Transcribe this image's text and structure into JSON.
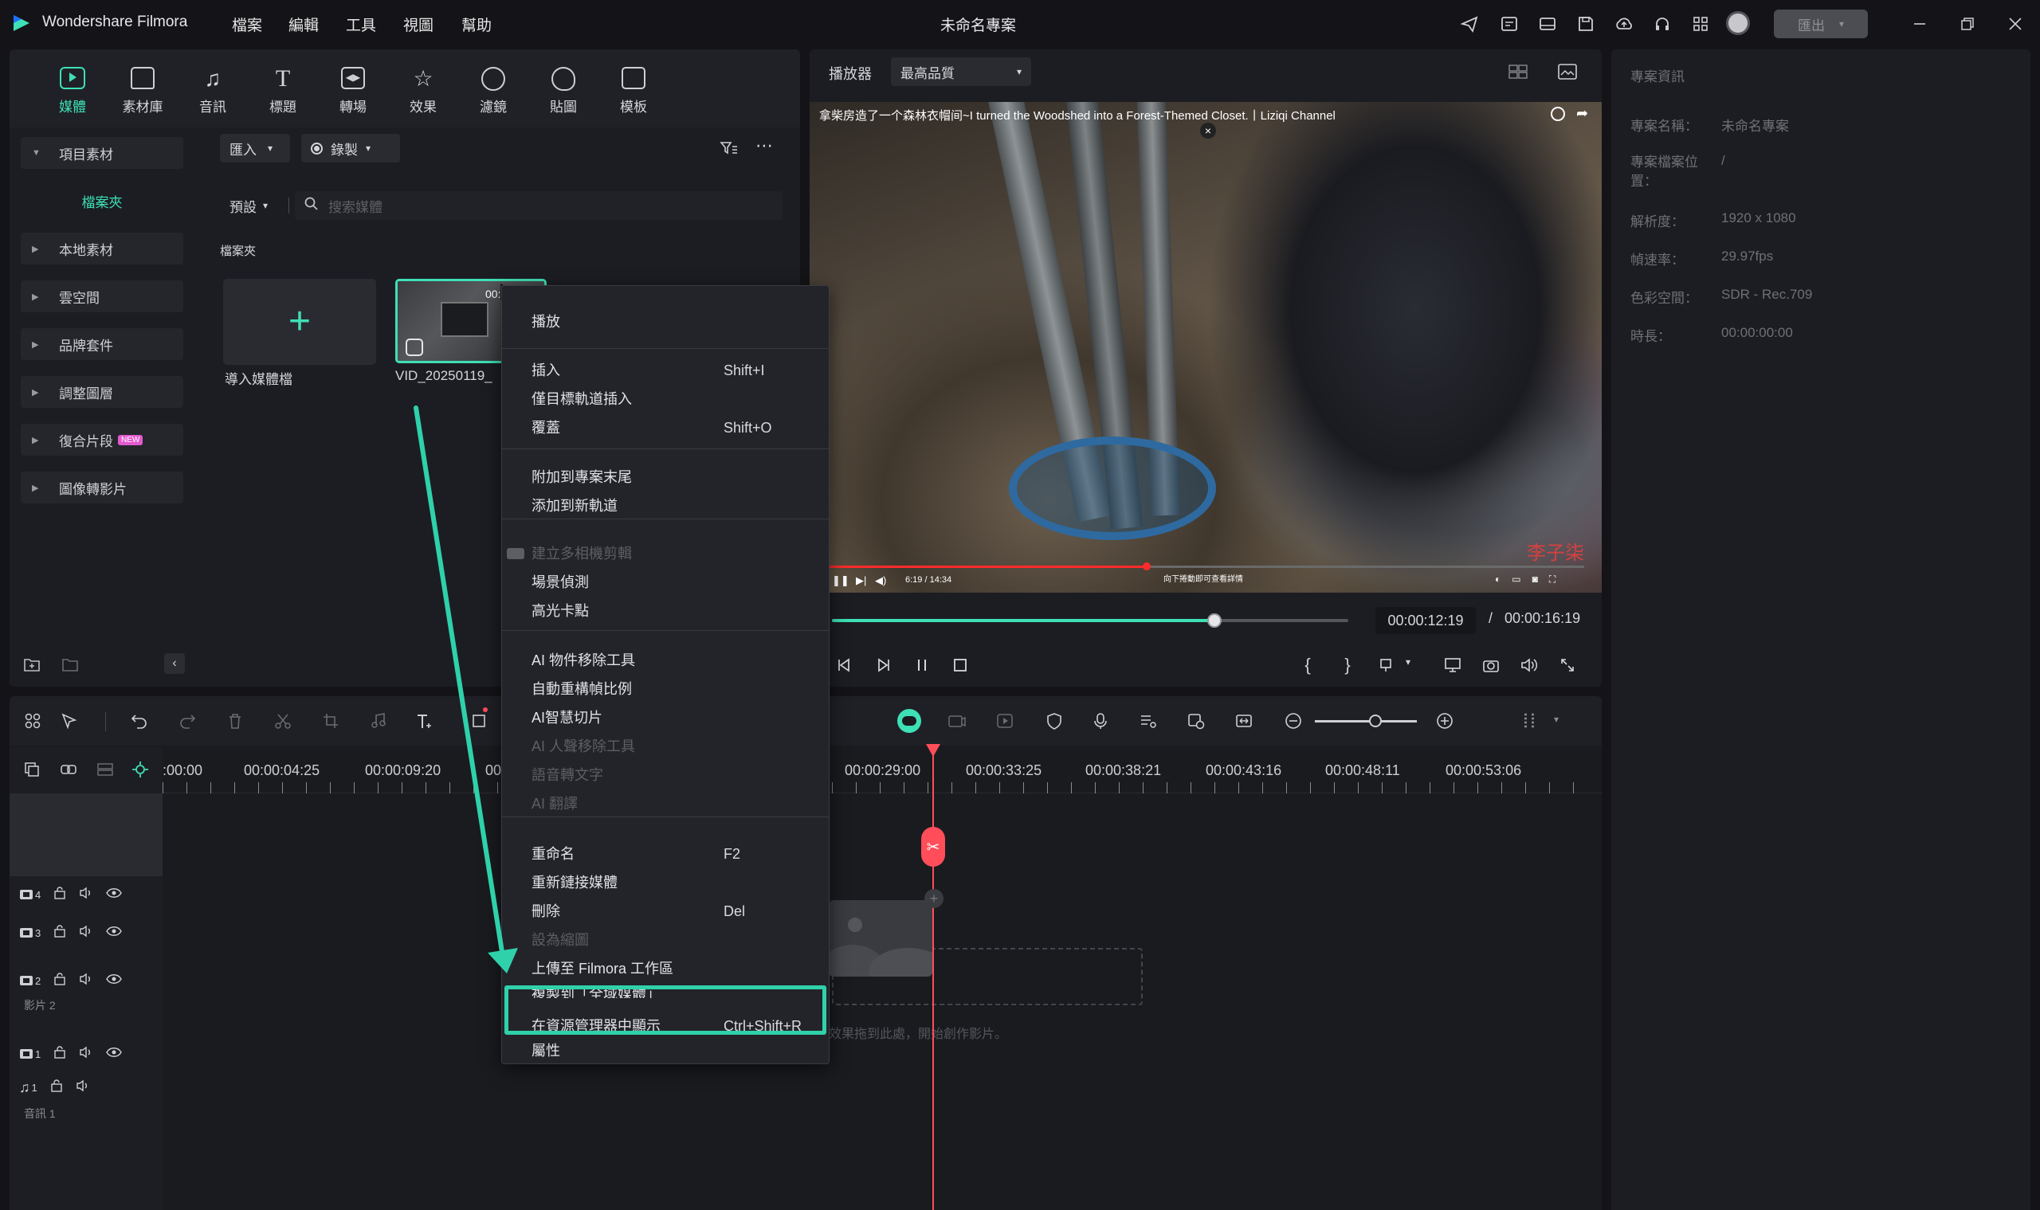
{
  "app": {
    "name": "Wondershare Filmora",
    "project_title": "未命名專案",
    "menu": [
      "檔案",
      "編輯",
      "工具",
      "視圖",
      "幫助"
    ],
    "export_label": "匯出"
  },
  "media_tabs": [
    {
      "label": "媒體",
      "active": true
    },
    {
      "label": "素材庫"
    },
    {
      "label": "音訊"
    },
    {
      "label": "標題"
    },
    {
      "label": "轉場"
    },
    {
      "label": "效果"
    },
    {
      "label": "濾鏡"
    },
    {
      "label": "貼圖"
    },
    {
      "label": "模板"
    }
  ],
  "sidebar": {
    "items": [
      {
        "label": "項目素材",
        "expanded": true
      },
      {
        "label": "檔案夾",
        "sub": true
      },
      {
        "label": "本地素材"
      },
      {
        "label": "雲空間"
      },
      {
        "label": "品牌套件"
      },
      {
        "label": "調整圖層"
      },
      {
        "label": "復合片段",
        "badge": "NEW"
      },
      {
        "label": "圖像轉影片"
      }
    ]
  },
  "media": {
    "import_label": "匯入",
    "record_label": "錄製",
    "sort_label": "預設",
    "search_placeholder": "搜索媒體",
    "folder_label": "檔案夾",
    "import_tile_label": "導入媒體檔",
    "clip_name": "VID_20250119_",
    "clip_time": "00:"
  },
  "player": {
    "label": "播放器",
    "quality": "最高品質",
    "video_title": "拿柴房造了一个森林衣帽间~I turned the Woodshed into a Forest-Themed Closet.丨Liziqi Channel",
    "embed_time": "6:19 / 14:34",
    "embed_hint": "向下捲動即可查看詳情",
    "watermark": "李子柒",
    "current_time": "00:00:12:19",
    "total_time": "00:00:16:19",
    "progress": 0.74
  },
  "project_info": {
    "header": "專案資訊",
    "rows": [
      {
        "label": "專案名稱：",
        "value": "未命名專案"
      },
      {
        "label": "專案檔案位置：",
        "value": "/"
      },
      {
        "label": "解析度：",
        "value": "1920 x 1080"
      },
      {
        "label": "幀速率：",
        "value": "29.97fps"
      },
      {
        "label": "色彩空間：",
        "value": "SDR - Rec.709"
      },
      {
        "label": "時長：",
        "value": "00:00:00:00"
      }
    ]
  },
  "context_menu": {
    "items": [
      {
        "label": "播放"
      },
      {
        "label": "插入",
        "shortcut": "Shift+I"
      },
      {
        "label": "僅目標軌道插入"
      },
      {
        "label": "覆蓋",
        "shortcut": "Shift+O"
      },
      {
        "label": "附加到專案末尾"
      },
      {
        "label": "添加到新軌道"
      },
      {
        "label": "建立多相機剪輯",
        "disabled": true
      },
      {
        "label": "場景偵測"
      },
      {
        "label": "高光卡點"
      },
      {
        "label": "AI 物件移除工具"
      },
      {
        "label": "自動重構幀比例"
      },
      {
        "label": "AI智慧切片"
      },
      {
        "label": "AI 人聲移除工具",
        "disabled": true
      },
      {
        "label": "語音轉文字",
        "disabled": true
      },
      {
        "label": "AI 翻譯",
        "disabled": true
      },
      {
        "label": "重命名",
        "shortcut": "F2"
      },
      {
        "label": "重新鏈接媒體"
      },
      {
        "label": "刪除",
        "shortcut": "Del"
      },
      {
        "label": "設為縮圖",
        "disabled": true
      },
      {
        "label": "上傳至 Filmora 工作區"
      },
      {
        "label": "複製到「全域媒體」"
      },
      {
        "label": "在資源管理器中顯示",
        "shortcut": "Ctrl+Shift+R",
        "highlighted": true
      },
      {
        "label": "屬性"
      }
    ]
  },
  "timeline": {
    "ticks": [
      ":00:00",
      "00:00:04:25",
      "00:00:09:20",
      "00",
      "00:00:29:00",
      "00:00:33:25",
      "00:00:38:21",
      "00:00:43:16",
      "00:00:48:11",
      "00:00:53:06"
    ],
    "tracks": [
      {
        "num": "4"
      },
      {
        "num": "3"
      },
      {
        "num": "2",
        "name": "影片 2"
      },
      {
        "num": "1"
      },
      {
        "num": "1",
        "name": "音訊 1",
        "audio": true
      }
    ],
    "drop_hint": "效果拖到此處，開始創作影片。"
  },
  "colors": {
    "accent": "#3ee0b5",
    "playhead": "#ff4d5a",
    "highlight": "#2fd1aa"
  }
}
